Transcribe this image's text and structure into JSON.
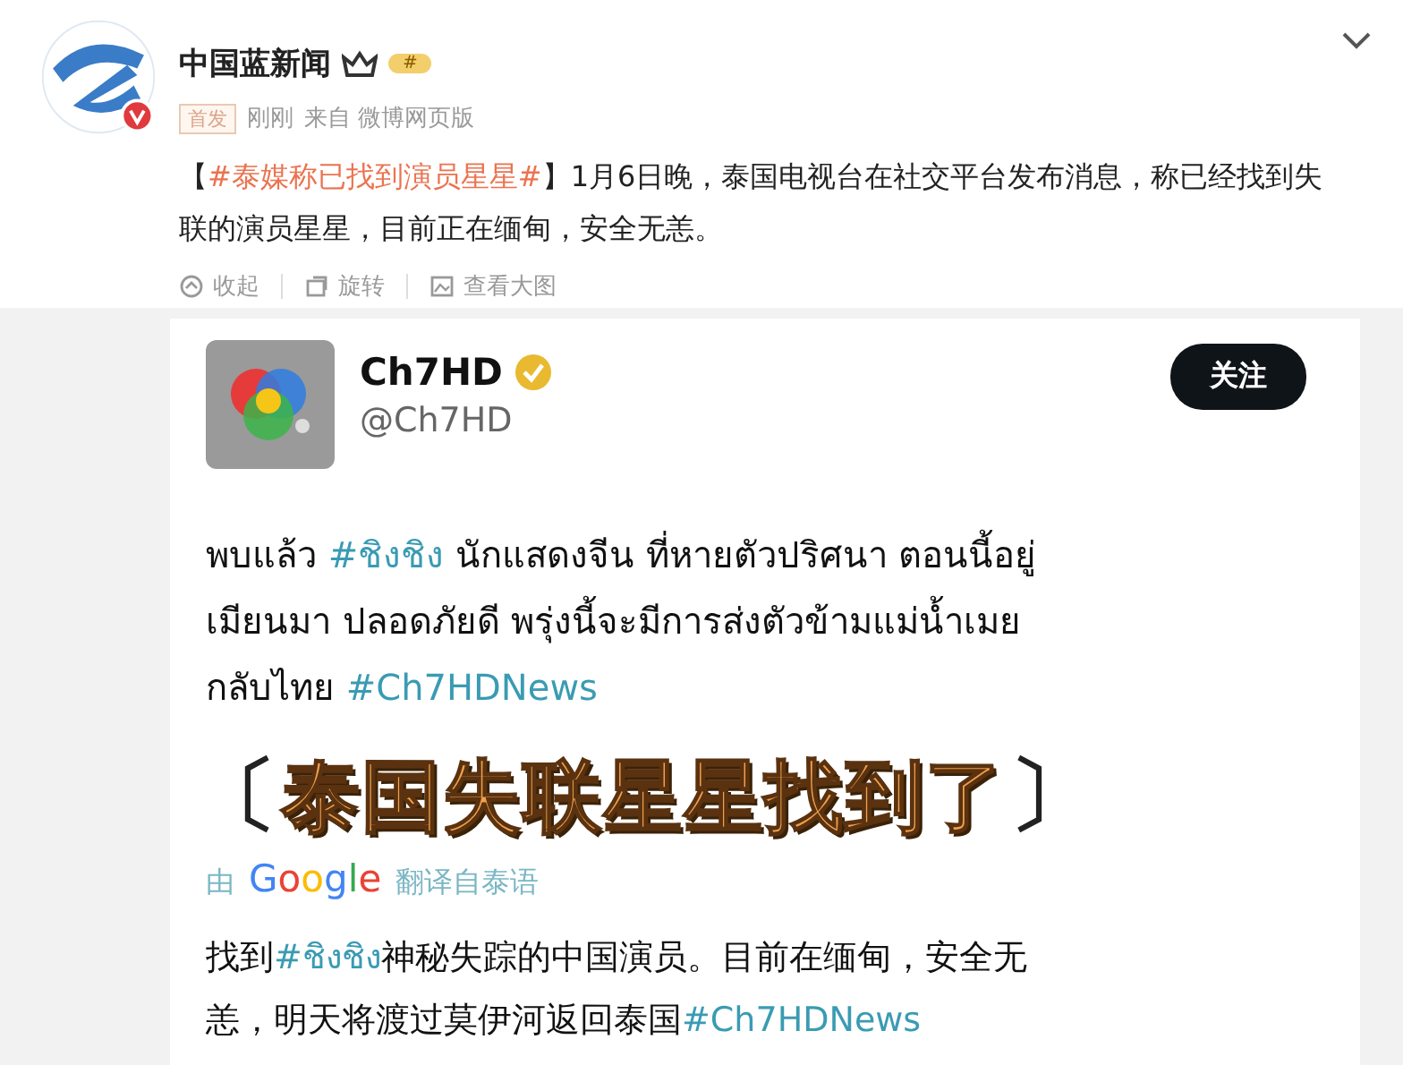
{
  "post": {
    "author": "中国蓝新闻",
    "badge": "#",
    "tag": "首发",
    "time": "刚刚",
    "source": "来自 微博网页版",
    "text": [
      {
        "text": "【",
        "tag": false
      },
      {
        "text": "#泰媒称已找到演员星星#",
        "tag": true
      },
      {
        "text": "】1月6日晚，泰国电视台在社交平台发布消息，称已经找到失联的演员星星，目前正在缅甸，安全无恙。",
        "tag": false
      }
    ],
    "actions": [
      {
        "kind": "collapse",
        "label": "收起"
      },
      {
        "kind": "rotate",
        "label": "旋转"
      },
      {
        "kind": "view",
        "label": "查看大图"
      }
    ]
  },
  "tweet": {
    "name": "Ch7HD",
    "handle": "@Ch7HD",
    "follow": "关注",
    "lines": [
      [
        {
          "text": "พบแล้ว ",
          "tag": false
        },
        {
          "text": "#ชิงชิง",
          "tag": true
        },
        {
          "text": " นักแสดงจีน ที่หายตัวปริศนา ตอนนี้อยู่",
          "tag": false
        }
      ],
      [
        {
          "text": "เมียนมา ปลอดภัยดี พรุ่งนี้จะมีการส่งตัวข้ามแม่น้ำเมย",
          "tag": false
        }
      ],
      [
        {
          "text": "กลับไทย ",
          "tag": false
        },
        {
          "text": "#Ch7HDNews",
          "tag": true
        }
      ]
    ],
    "translated_prefix": "由",
    "translator": "Google",
    "translated_suffix": "翻译自泰语",
    "translation": [
      [
        {
          "text": "找到",
          "tag": false
        },
        {
          "text": "#ชิงชิง",
          "tag": true
        },
        {
          "text": "神秘失踪的中国演员。目前在缅甸，安全无",
          "tag": false
        }
      ],
      [
        {
          "text": "恙，明天将渡过莫伊河返回泰国",
          "tag": false
        },
        {
          "text": "#Ch7HDNews",
          "tag": true
        }
      ]
    ]
  },
  "caption": {
    "open": "〔",
    "text": "泰国失联星星找到了",
    "close": "〕"
  }
}
